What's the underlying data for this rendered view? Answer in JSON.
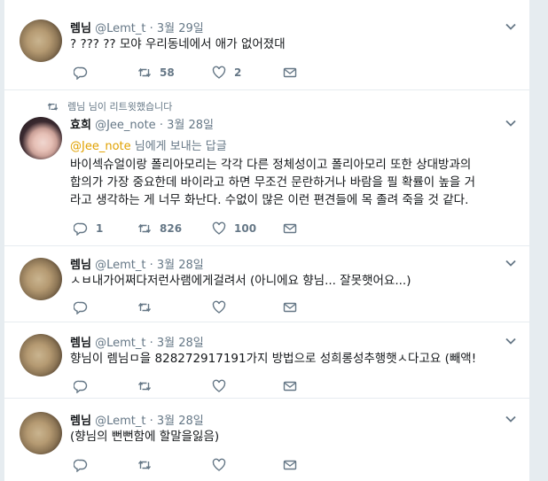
{
  "tweets": [
    {
      "name": "렘님",
      "handle": "@Lemt_t",
      "dot": "·",
      "time": "3월 29일",
      "text": "? ??? ?? 모야 우리동네에서 애가 없어졌대",
      "reply": "",
      "retweets": "58",
      "likes": "2"
    },
    {
      "context": "렘님 님이 리트윗했습니다",
      "name": "효희",
      "handle": "@Jee_note",
      "dot": "·",
      "time": "3월 28일",
      "reply_to_mention": "@Jee_note",
      "reply_to_suffix": "님에게 보내는 답글",
      "text_lines": [
        "바이섹슈얼이랑 폴리아모리는 각각 다른 정체성이고 폴리아모리 또한 상대방과의",
        "합의가 가장 중요한데 바이라고 하면 무조건 문란하거나 바람을 필 확률이 높을 거",
        "라고 생각하는 게 너무 화난다. 수없이 많은 이런 편견들에 목 졸려 죽을 것 같다."
      ],
      "reply": "1",
      "retweets": "826",
      "likes": "100"
    },
    {
      "name": "렘님",
      "handle": "@Lemt_t",
      "dot": "·",
      "time": "3월 28일",
      "text": "ㅅㅂ내가어쩌다저런사램에게걸려서 (아니에요 향님... 잘못햇어요...)",
      "reply": "",
      "retweets": "",
      "likes": ""
    },
    {
      "name": "렘님",
      "handle": "@Lemt_t",
      "dot": "·",
      "time": "3월 28일",
      "text": "향님이 렘님ㅁ을 828272917191가지 방법으로 성희롱성추행햇ㅅ다고요 (빼액!",
      "reply": "",
      "retweets": "",
      "likes": ""
    },
    {
      "name": "렘님",
      "handle": "@Lemt_t",
      "dot": "·",
      "time": "3월 28일",
      "text": "(향님의 뻔뻔함에 할말을잃음)",
      "reply": "",
      "retweets": "",
      "likes": ""
    }
  ]
}
